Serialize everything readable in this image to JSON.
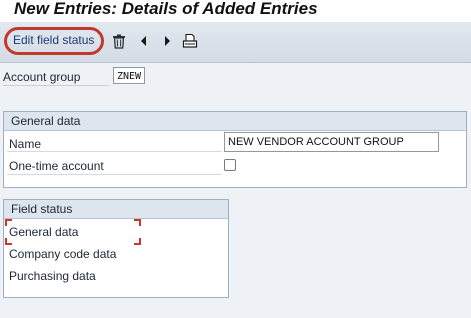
{
  "title": "New Entries: Details of Added Entries",
  "toolbar": {
    "edit_field_status_label": "Edit field status",
    "icons": [
      "delete-icon",
      "previous-entry-icon",
      "next-entry-icon",
      "print-icon"
    ],
    "highlight_color": "#c0392b"
  },
  "account_group": {
    "label": "Account group",
    "value": "ZNEW"
  },
  "general_data": {
    "title": "General data",
    "name_label": "Name",
    "name_value": "NEW VENDOR ACCOUNT GROUP",
    "one_time_label": "One-time account",
    "one_time_checked": false
  },
  "field_status": {
    "title": "Field status",
    "items": [
      "General data",
      "Company code data",
      "Purchasing data"
    ]
  }
}
